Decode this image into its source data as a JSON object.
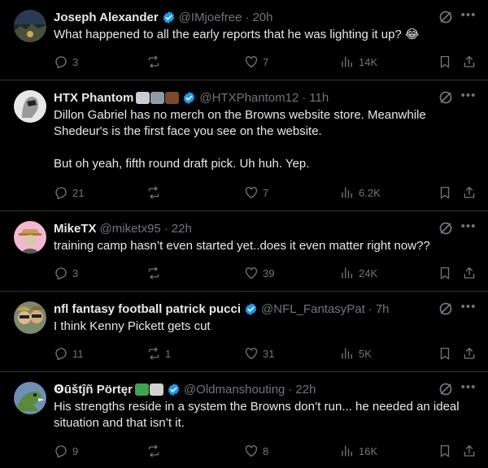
{
  "colors": {
    "background": "#000000",
    "text": "#e7e9ea",
    "secondary": "#71767b",
    "divider": "#2f3336",
    "verified": "#1d9bf0"
  },
  "tweets": [
    {
      "name": "Joseph Alexander",
      "verified": true,
      "handle": "@IMjoefree",
      "time": "20h",
      "text": "What happened to all the early reports that he was lighting it up? 😂",
      "replies": "3",
      "reposts": "",
      "likes": "7",
      "views": "14K"
    },
    {
      "name": "HTX Phantom",
      "name_emojis": [
        "football-helmet-emoji",
        "elephant-emoji",
        "bison-emoji"
      ],
      "verified": true,
      "handle": "@HTXPhantom12",
      "time": "11h",
      "text": "Dillon Gabriel has no merch on the Browns website store. Meanwhile Shedeur's is the first face you see on the website.\n\nBut oh yeah, fifth round draft pick. Uh huh. Yep.",
      "replies": "21",
      "reposts": "",
      "likes": "7",
      "views": "6.2K"
    },
    {
      "name": "MikeTX",
      "verified": false,
      "handle": "@miketx95",
      "time": "22h",
      "text": "training camp hasn’t even started yet..does it even matter right now??",
      "replies": "3",
      "reposts": "",
      "likes": "39",
      "views": "24K"
    },
    {
      "name": "nfl fantasy football patrick pucci",
      "verified": true,
      "handle": "@NFL_FantasyPat",
      "time": "7h",
      "text": "I think Kenny Pickett gets cut",
      "replies": "11",
      "reposts": "1",
      "likes": "31",
      "views": "5K"
    },
    {
      "name": "Ꙩūštĵñ Pörtęr",
      "name_emojis": [
        "snake-emoji",
        "skull-crossbones-emoji"
      ],
      "verified": true,
      "handle": "@Oldmanshouting",
      "time": "22h",
      "text": "His strengths reside in a system the Browns don’t run... he needed an ideal situation and that isn’t it.",
      "replies": "9",
      "reposts": "",
      "likes": "8",
      "views": "16K"
    }
  ]
}
